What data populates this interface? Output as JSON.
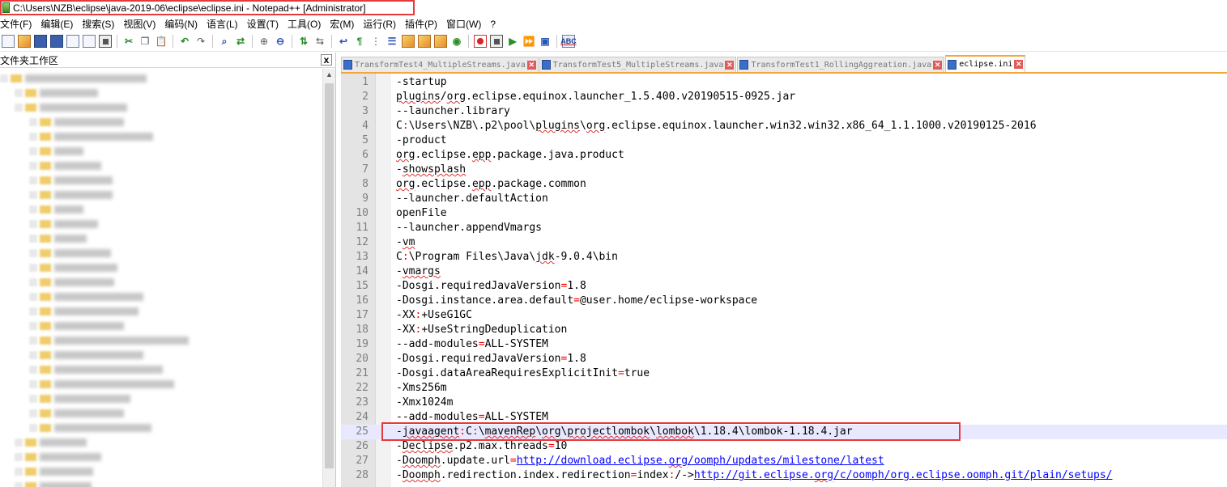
{
  "window": {
    "title": "C:\\Users\\NZB\\eclipse\\java-2019-06\\eclipse\\eclipse.ini - Notepad++ [Administrator]"
  },
  "menu": [
    "文件(F)",
    "编辑(E)",
    "搜索(S)",
    "视图(V)",
    "编码(N)",
    "语言(L)",
    "设置(T)",
    "工具(O)",
    "宏(M)",
    "运行(R)",
    "插件(P)",
    "窗口(W)",
    "?"
  ],
  "toolbar": {
    "icons": [
      "new-file-icon",
      "open-file-icon",
      "save-icon",
      "save-all-icon",
      "close-icon",
      "close-all-icon",
      "print-icon",
      "cut-icon",
      "copy-icon",
      "paste-icon",
      "undo-icon",
      "redo-icon",
      "find-icon",
      "replace-icon",
      "zoom-in-icon",
      "zoom-out-icon",
      "sync-vertical-icon",
      "sync-horizontal-icon",
      "word-wrap-icon",
      "show-all-chars-icon",
      "indent-guide-icon",
      "language-icon",
      "doc-map-icon",
      "function-list-icon",
      "folder-workspace-icon",
      "monitoring-icon",
      "record-macro-icon",
      "stop-record-icon",
      "play-macro-icon",
      "run-multiple-icon",
      "save-macro-icon",
      "spell-check-icon"
    ],
    "spell_check_label": "ABC"
  },
  "workspace": {
    "title": "文件夹工作区",
    "close": "x"
  },
  "tabs": [
    {
      "label": "TransformTest4_MultipleStreams.java",
      "active": false
    },
    {
      "label": "TransformTest5_MultipleStreams.java",
      "active": false
    },
    {
      "label": "TransformTest1_RollingAggreation.java",
      "active": false
    },
    {
      "label": "eclipse.ini",
      "active": true
    }
  ],
  "editor": {
    "current_line": 25,
    "lines": [
      "-startup",
      "plugins/org.eclipse.equinox.launcher_1.5.400.v20190515-0925.jar",
      "--launcher.library",
      "C:\\Users\\NZB\\.p2\\pool\\plugins\\org.eclipse.equinox.launcher.win32.win32.x86_64_1.1.1000.v20190125-2016",
      "-product",
      "org.eclipse.epp.package.java.product",
      "-showsplash",
      "org.eclipse.epp.package.common",
      "--launcher.defaultAction",
      "openFile",
      "--launcher.appendVmargs",
      "-vm",
      "C:\\Program Files\\Java\\jdk-9.0.4\\bin",
      "-vmargs",
      "-Dosgi.requiredJavaVersion=1.8",
      "-Dosgi.instance.area.default=@user.home/eclipse-workspace",
      "-XX:+UseG1GC",
      "-XX:+UseStringDeduplication",
      "--add-modules=ALL-SYSTEM",
      "-Dosgi.requiredJavaVersion=1.8",
      "-Dosgi.dataAreaRequiresExplicitInit=true",
      "-Xms256m",
      "-Xmx1024m",
      "--add-modules=ALL-SYSTEM",
      "-javaagent:C:\\mavenRep\\org\\projectlombok\\lombok\\1.18.4\\lombok-1.18.4.jar",
      "-Declipse.p2.max.threads=10",
      "-Doomph.update.url=http://download.eclipse.org/oomph/updates/milestone/latest",
      "-Doomph.redirection.index.redirection=index:/->http://git.eclipse.org/c/oomph/org.eclipse.oomph.git/plain/setups/"
    ]
  }
}
